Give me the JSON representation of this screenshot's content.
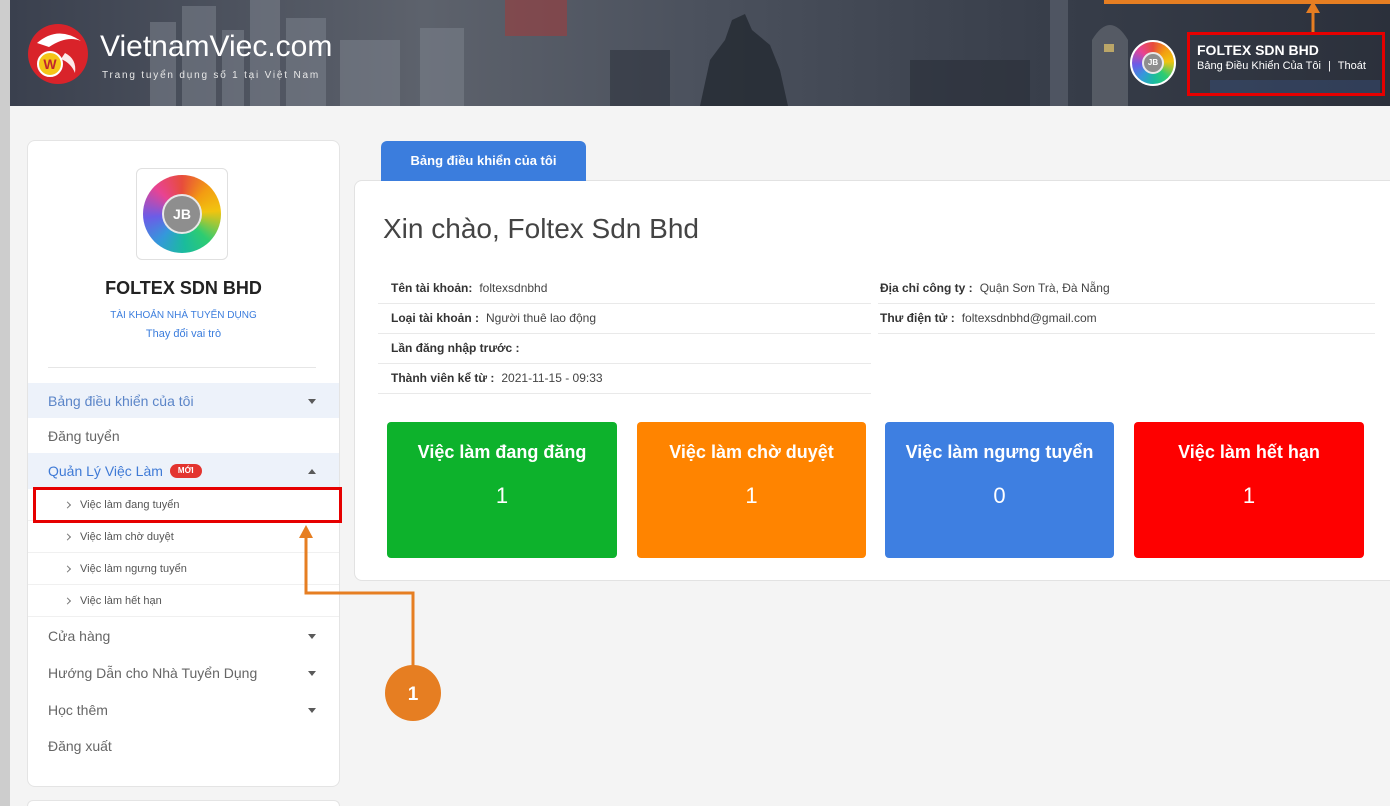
{
  "header": {
    "logo_letter": "W",
    "brand_name": "VietnamViec.com",
    "brand_tagline": "Trang tuyển dụng số 1 tại Việt Nam",
    "avatar_monogram": "JB",
    "user_name": "FOLTEX SDN BHD",
    "dashboard_link": "Bảng Điều Khiển Của Tôi",
    "link_separator": "|",
    "logout_link": "Thoát"
  },
  "sidebar": {
    "avatar_monogram": "JB",
    "company_name": "FOLTEX SDN BHD",
    "account_type": "TÀI KHOẢN NHÀ TUYỂN DỤNG",
    "change_role": "Thay đổi vai trò",
    "menu": [
      {
        "label": "Bảng điều khiển của tôi",
        "icon": "caret-down-icon",
        "highlighted": true
      },
      {
        "label": "Đăng tuyển"
      },
      {
        "label": "Quản Lý Việc Làm",
        "badge": "MỚI",
        "icon": "caret-up-icon",
        "highlighted": true,
        "expanded": true
      },
      {
        "label": "Cửa hàng",
        "icon": "caret-down-icon"
      },
      {
        "label": "Hướng Dẫn cho Nhà Tuyển Dụng",
        "icon": "caret-down-icon"
      },
      {
        "label": "Học thêm",
        "icon": "caret-down-icon"
      },
      {
        "label": "Đăng xuất"
      }
    ],
    "job_submenu": [
      {
        "label": "Việc làm đang tuyển",
        "icon": "chevron-right-icon"
      },
      {
        "label": "Việc làm chờ duyệt",
        "icon": "chevron-right-icon"
      },
      {
        "label": "Việc làm ngưng tuyển",
        "icon": "chevron-right-icon"
      },
      {
        "label": "Việc làm hết hạn",
        "icon": "chevron-right-icon"
      }
    ]
  },
  "main": {
    "tab_label": "Bảng điều khiển của tôi",
    "greeting": "Xin chào, Foltex Sdn Bhd",
    "account_info": [
      {
        "label": "Tên tài khoản:",
        "value": "foltexsdnbhd"
      },
      {
        "label": "Loại tài khoản :",
        "value": "Người thuê lao động"
      },
      {
        "label": "Lần đăng nhập trước :"
      },
      {
        "label": "Thành viên kể từ :",
        "value": "2021-11-15 - 09:33"
      }
    ],
    "company_info": [
      {
        "label": "Địa chỉ công ty :",
        "value": "Quận Sơn Trà, Đà Nẵng"
      },
      {
        "label": "Thư điện tử :",
        "value": "foltexsdnbhd@gmail.com"
      }
    ],
    "stats": [
      {
        "title": "Việc làm đang đăng",
        "count": 1,
        "color": "#0db22c"
      },
      {
        "title": "Việc làm chờ duyệt",
        "count": 1,
        "color": "#ff8400"
      },
      {
        "title": "Việc làm ngưng tuyển",
        "count": 0,
        "color": "#3e7fe1"
      },
      {
        "title": "Việc làm hết hạn",
        "count": 1,
        "color": "#fe0000"
      }
    ]
  },
  "annotations": {
    "step_number": "1"
  },
  "colors": {
    "accent": "#3b7ddd",
    "badge": "#e3342f",
    "annotation_orange": "#e67e22",
    "annotation_red": "#e60000"
  }
}
